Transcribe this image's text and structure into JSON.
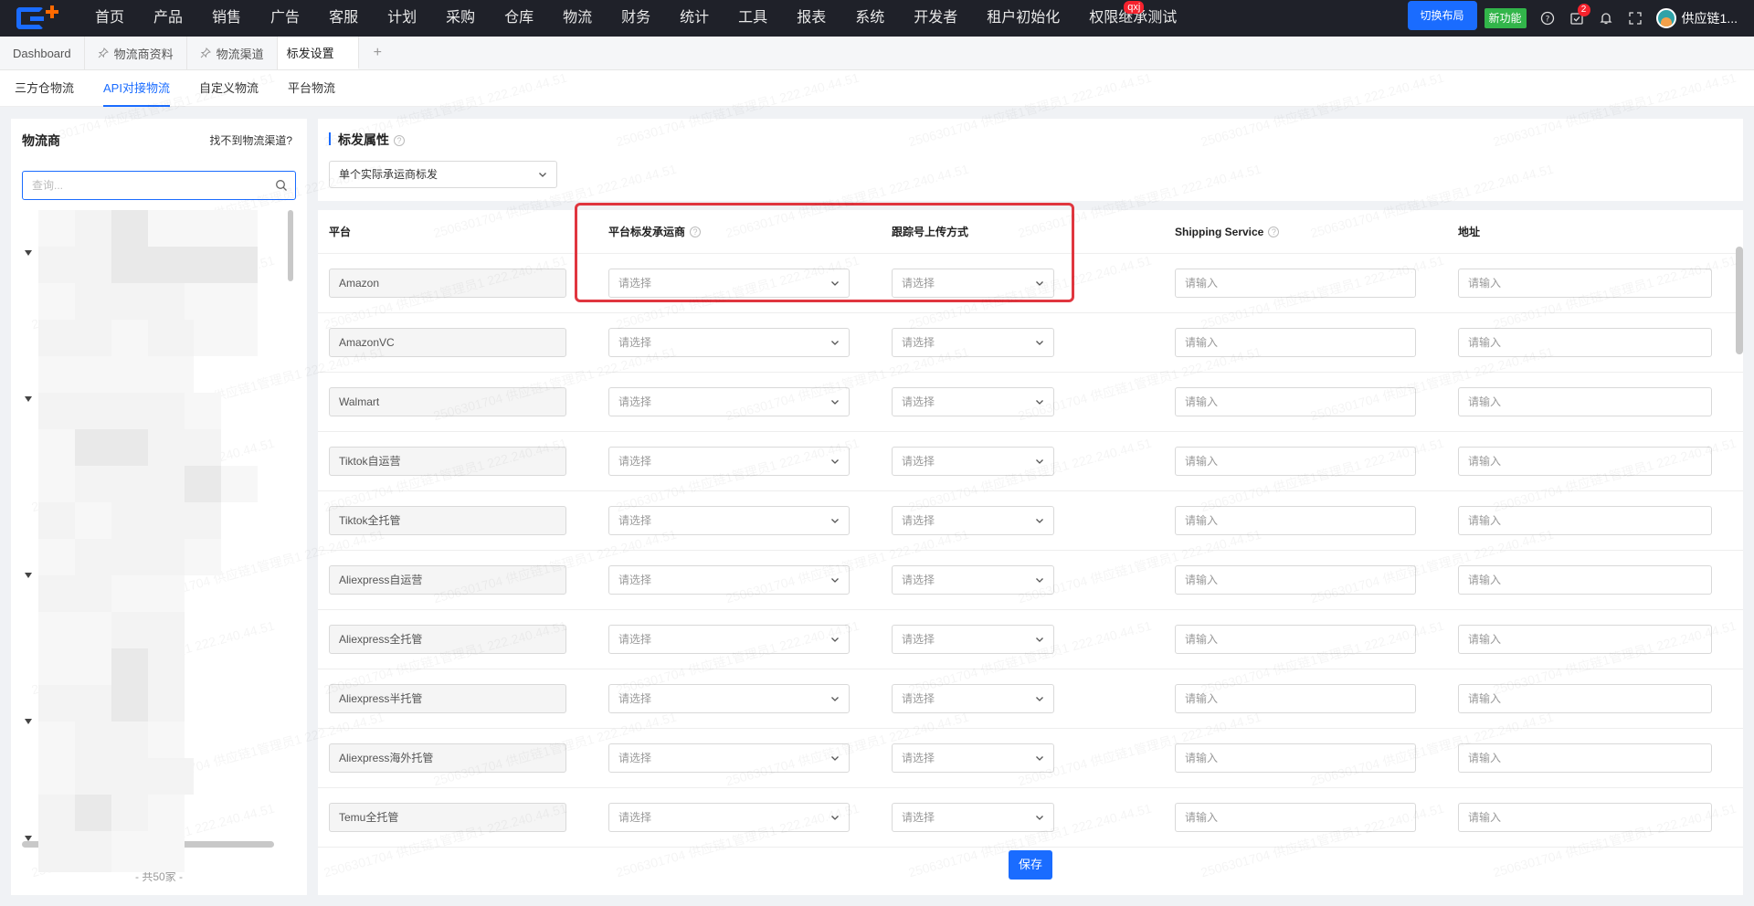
{
  "nav": {
    "menu": [
      "首页",
      "产品",
      "销售",
      "广告",
      "客服",
      "计划",
      "采购",
      "仓库",
      "物流",
      "财务",
      "统计",
      "工具",
      "报表",
      "系统",
      "开发者",
      "租户初始化",
      "权限继承测试"
    ],
    "menu_badge": "qxj",
    "switch_layout": "切换布局",
    "new_feature": "新功能",
    "task_badge": "2",
    "user_name": "供应链1..."
  },
  "page_tabs": {
    "items": [
      "Dashboard",
      "物流商资料",
      "物流渠道",
      "标发设置"
    ],
    "active_index": 3,
    "add": "+"
  },
  "sub_tabs": {
    "items": [
      "三方仓物流",
      "API对接物流",
      "自定义物流",
      "平台物流"
    ],
    "active_index": 1
  },
  "left": {
    "title": "物流商",
    "link": "找不到物流渠道?",
    "search_placeholder": "查询...",
    "total": "- 共50家 -"
  },
  "right": {
    "title": "标发属性",
    "mode_select": "单个实际承运商标发",
    "columns": [
      "平台",
      "平台标发承运商",
      "跟踪号上传方式",
      "Shipping Service",
      "地址"
    ],
    "select_placeholder": "请选择",
    "input_placeholder": "请输入",
    "rows": [
      {
        "platform": "Amazon"
      },
      {
        "platform": "AmazonVC"
      },
      {
        "platform": "Walmart"
      },
      {
        "platform": "Tiktok自运营"
      },
      {
        "platform": "Tiktok全托管"
      },
      {
        "platform": "Aliexpress自运营"
      },
      {
        "platform": "Aliexpress全托管"
      },
      {
        "platform": "Aliexpress半托管"
      },
      {
        "platform": "Aliexpress海外托管"
      },
      {
        "platform": "Temu全托管"
      }
    ],
    "save": "保存"
  },
  "watermark": "2506301704 供应链1管理员1 222.240.44.51",
  "colors": {
    "accent": "#1a6cff",
    "nav_bg": "#1f2129",
    "new_feature": "#32b54a",
    "highlight": "#e0363f"
  }
}
